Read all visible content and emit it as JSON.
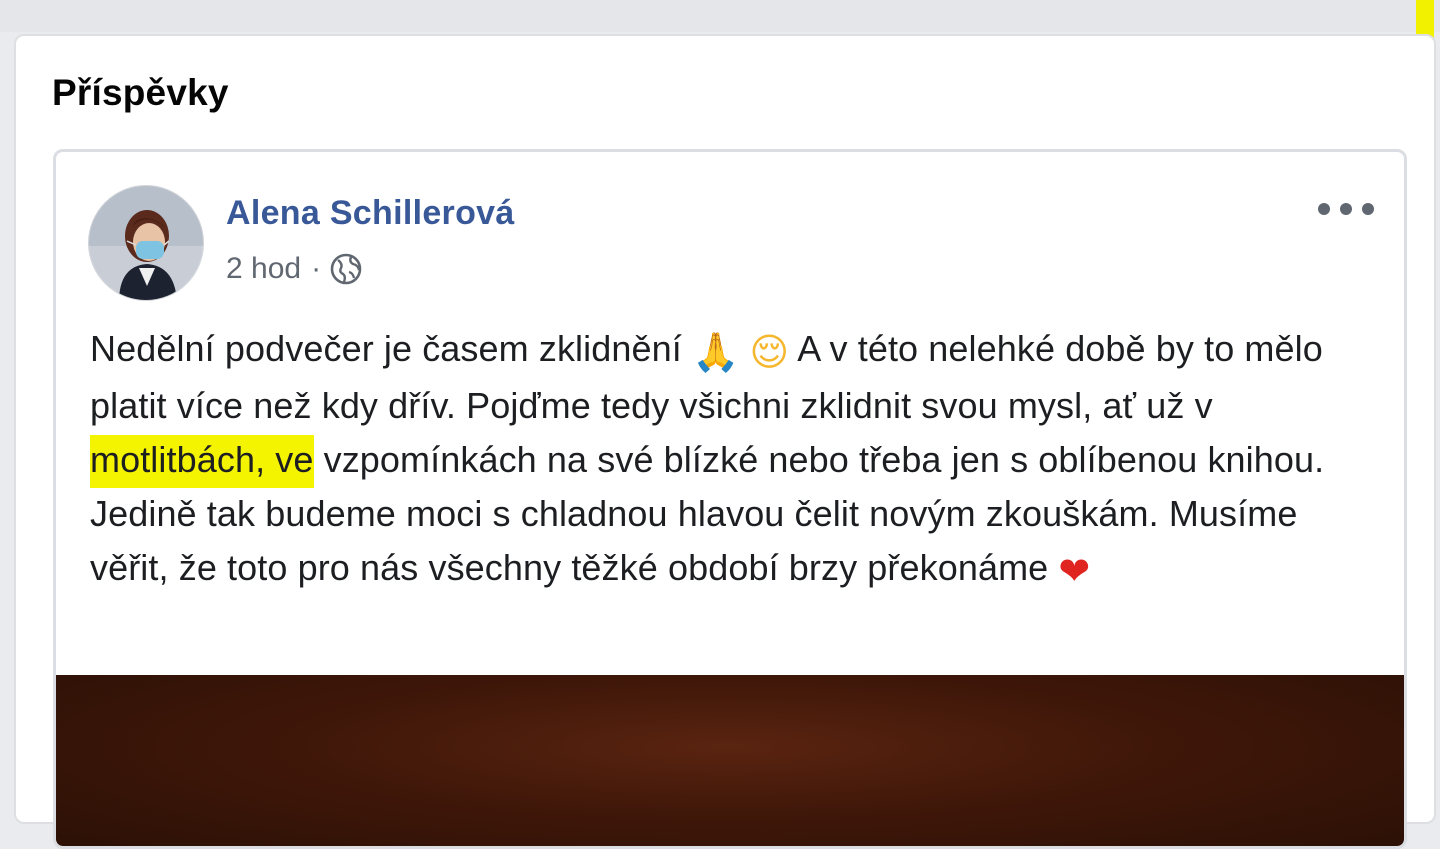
{
  "section": {
    "title": "Příspěvky"
  },
  "post": {
    "author": "Alena Schillerová",
    "time": "2 hod",
    "separator": "·",
    "privacy_icon": "globe-icon",
    "text": {
      "part1": "Nedělní podvečer je časem zklidnění ",
      "emoji1": "🙏",
      "emoji2": "😌",
      "part2": " A v této nelehké době by to mělo platit více než kdy dřív. Pojďme tedy všichni zklidnit svou mysl, ať už v",
      "highlight": " motlitbách, ve",
      "part3": " vzpomínkách na své blízké nebo třeba jen s oblíbenou knihou. Jedině tak budeme moci s chladnou hlavou čelit novým zkouškám. Musíme věřit, že toto pro nás všechny těžké období brzy překonáme ",
      "emoji3": "❤"
    }
  },
  "colors": {
    "author_link": "#385898",
    "highlight": "#f4f400",
    "page_background": "#e9ebee"
  }
}
